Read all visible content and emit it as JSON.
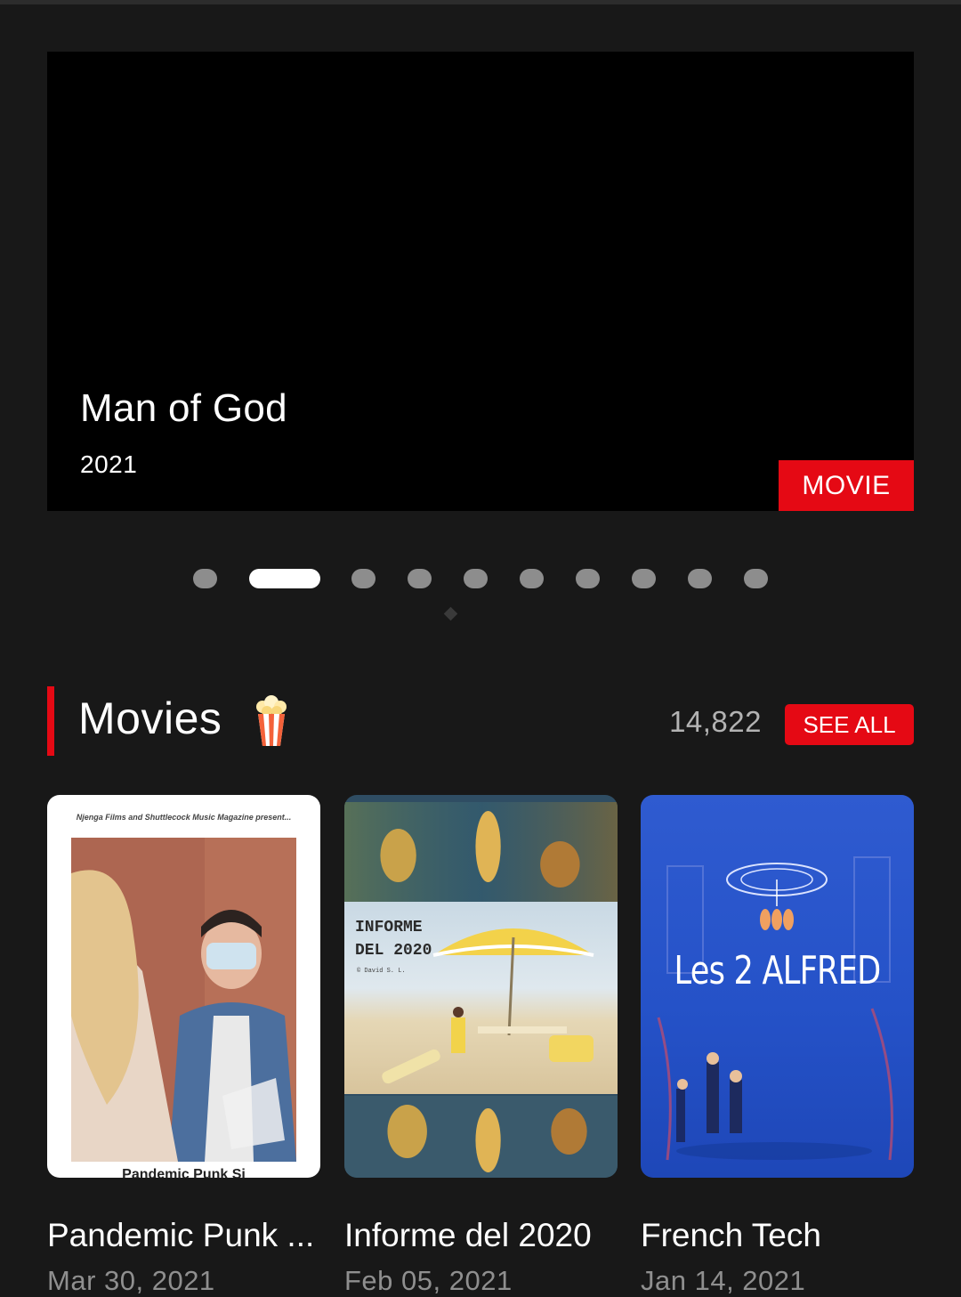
{
  "hero": {
    "title": "Man of God",
    "year": "2021",
    "badge": "MOVIE"
  },
  "carousel": {
    "dot_count": 10,
    "active_index": 1
  },
  "section": {
    "title": "Movies",
    "icon": "popcorn-icon",
    "count": "14,822",
    "see_all_label": "SEE ALL"
  },
  "movies": [
    {
      "title": "Pandemic Punk ...",
      "date": "Mar 30, 2021",
      "poster_top_text": "Njenga Films and Shuttlecock Music Magazine present...",
      "poster_bottom_text": "Pandemic Punk Si"
    },
    {
      "title": "Informe del 2020",
      "date": "Feb 05, 2021",
      "poster_text_line1": "INFORME",
      "poster_text_line2": "DEL 2020",
      "poster_small_text": "© David S. L."
    },
    {
      "title": "French Tech",
      "date": "Jan 14, 2021",
      "poster_title": "Les 2 ALFRED"
    }
  ],
  "colors": {
    "background": "#181818",
    "accent": "#e50914",
    "muted_text": "#8f8f8f"
  }
}
